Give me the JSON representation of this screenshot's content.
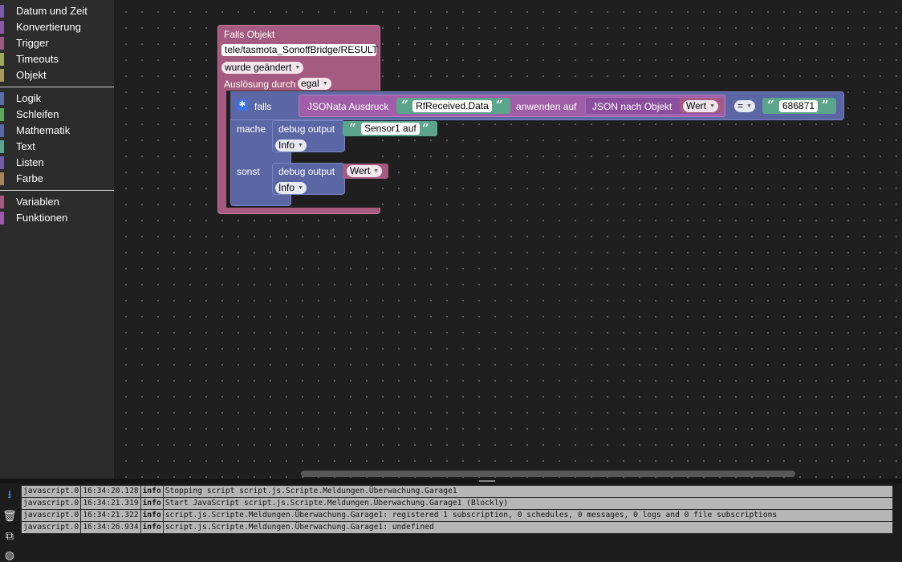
{
  "sidebar": {
    "items": [
      {
        "label": "Datum und Zeit",
        "color": "#7b5ca8"
      },
      {
        "label": "Konvertierung",
        "color": "#8a5aa6"
      },
      {
        "label": "Trigger",
        "color": "#9b5b7f"
      },
      {
        "label": "Timeouts",
        "color": "#9ca95c"
      },
      {
        "label": "Objekt",
        "color": "#a8985c"
      },
      {
        "label": "Logik",
        "color": "#5b6fa8"
      },
      {
        "label": "Schleifen",
        "color": "#5ca85c"
      },
      {
        "label": "Mathematik",
        "color": "#5c68a6"
      },
      {
        "label": "Text",
        "color": "#5ca68d"
      },
      {
        "label": "Listen",
        "color": "#745ca6"
      },
      {
        "label": "Farbe",
        "color": "#a6855c"
      },
      {
        "label": "Variablen",
        "color": "#a55b80"
      },
      {
        "label": "Funktionen",
        "color": "#995ba5"
      }
    ]
  },
  "blocks": {
    "trigger": {
      "title": "Falls Objekt",
      "object_id": "tele/tasmota_SonoffBridge/RESULT",
      "condition": "wurde geändert",
      "ack_label": "Auslösung durch",
      "ack_value": "egal",
      "color": "#a55b80"
    },
    "if_block": {
      "if_label": "falls",
      "do_label": "mache",
      "else_label": "sonst",
      "color": "#5b67a5"
    },
    "jsonata": {
      "label": "JSONata Ausdruck",
      "expression": "RfReceived.Data",
      "apply_label": "anwenden auf",
      "color": "#a05ea8"
    },
    "json_to_object": {
      "label": "JSON nach Objekt",
      "color": "#8c4fa0"
    },
    "variable_wert": {
      "value": "Wert",
      "color": "#a55b80"
    },
    "compare": {
      "operator": "=",
      "color": "#5b67a5"
    },
    "number_text": {
      "value": "686871",
      "color": "#5ba58c"
    },
    "debug1": {
      "label": "debug output",
      "text": "Sensor1 auf",
      "level": "Info"
    },
    "debug2": {
      "label": "debug output",
      "variable": "Wert",
      "level": "Info"
    }
  },
  "log": {
    "rows": [
      {
        "source": "javascript.0",
        "time": "16:34:20.128",
        "severity": "info",
        "message": "Stopping script script.js.Scripte.Meldungen.Überwachung.Garage1"
      },
      {
        "source": "javascript.0",
        "time": "16:34:21.319",
        "severity": "info",
        "message": "Start JavaScript script.js.Scripte.Meldungen.Überwachung.Garage1 (Blockly)"
      },
      {
        "source": "javascript.0",
        "time": "16:34:21.322",
        "severity": "info",
        "message": "script.js.Scripte.Meldungen.Überwachung.Garage1: registered 1 subscription, 0 schedules, 0 messages, 0 logs and 0 file subscriptions"
      },
      {
        "source": "javascript.0",
        "time": "16:34:26.934",
        "severity": "info",
        "message": "script.js.Scripte.Meldungen.Überwachung.Garage1: undefined"
      }
    ]
  },
  "icons": {
    "scroll_down": "arrow-down-icon",
    "clear": "trash-icon",
    "copy": "copy-icon",
    "toggle": "panel-icon"
  }
}
